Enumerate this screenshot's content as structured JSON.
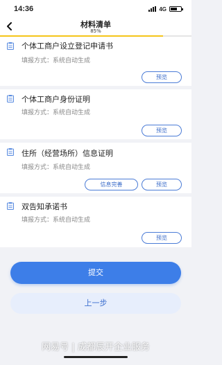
{
  "status_bar": {
    "time": "14:36",
    "network": "4G"
  },
  "header": {
    "title": "材料清单",
    "progress_label": "85%",
    "progress": 0.85
  },
  "documents": [
    {
      "title": "个体工商户设立登记申请书",
      "method": "填报方式：系统自动生成",
      "actions": [
        "预览"
      ]
    },
    {
      "title": "个体工商户身份证明",
      "method": "填报方式：系统自动生成",
      "actions": [
        "预览"
      ]
    },
    {
      "title": "住所（经营场所）信息证明",
      "method": "填报方式：系统自动生成",
      "actions": [
        "信息完善",
        "预览"
      ]
    },
    {
      "title": "双告知承诺书",
      "method": "填报方式：系统自动生成",
      "actions": [
        "预览"
      ]
    }
  ],
  "buttons": {
    "submit": "提交",
    "previous": "上一步"
  },
  "watermark": "网易号 | 成都辰开企业服务",
  "colors": {
    "accent": "#3d7ee8",
    "progress": "#f5c518",
    "outline": "#4a7bd6"
  },
  "icons": [
    "back-arrow-icon",
    "document-icon",
    "signal-icon",
    "battery-icon"
  ]
}
